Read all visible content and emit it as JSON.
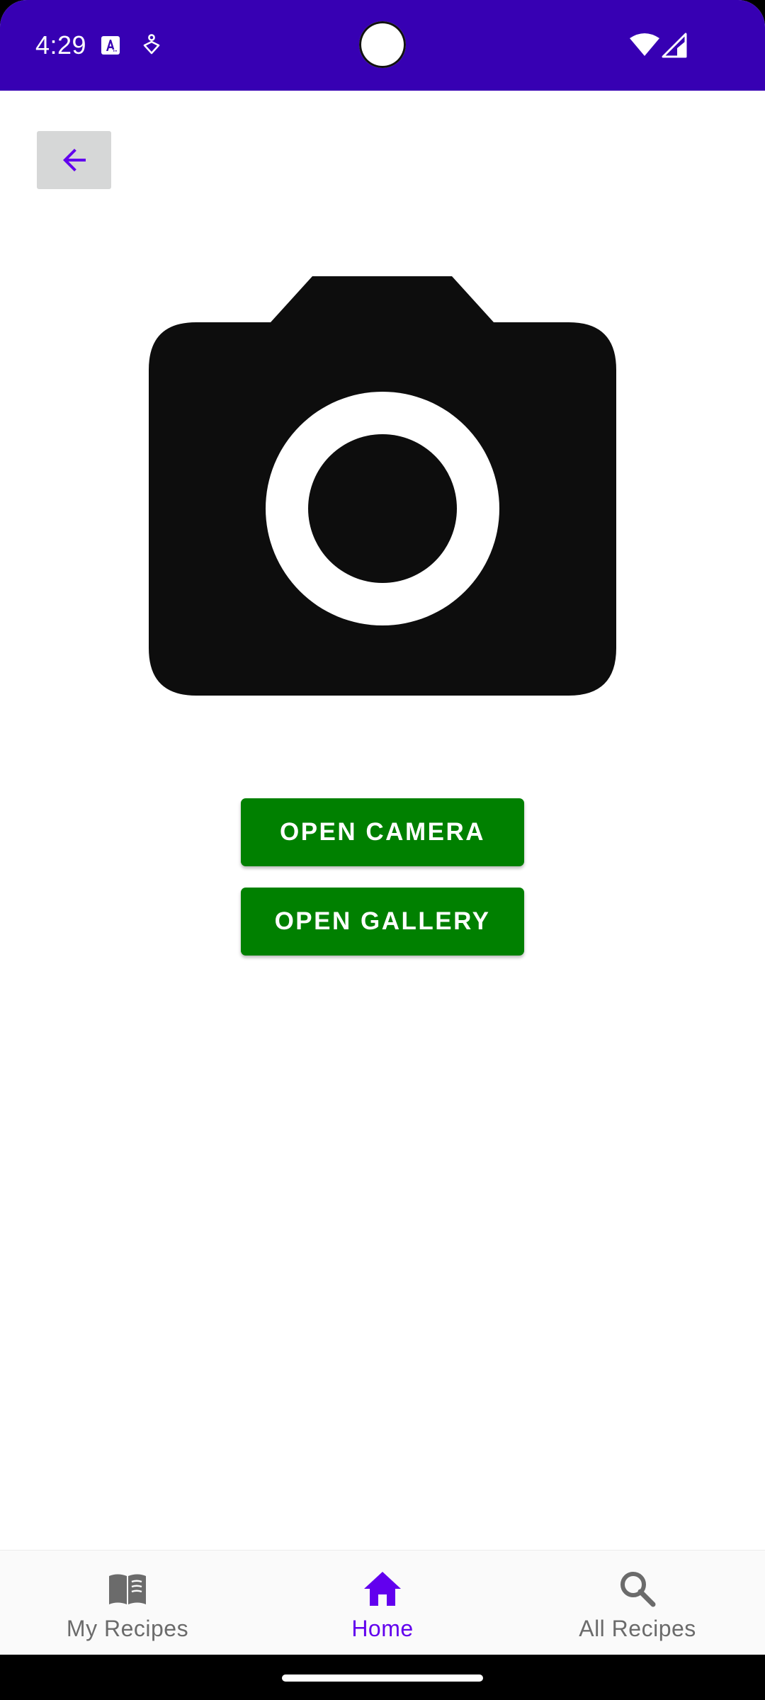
{
  "status_bar": {
    "time": "4:29",
    "background": "#3700b3",
    "icons": [
      "translate-notification-icon",
      "accessibility-notification-icon",
      "wifi-icon",
      "cell-signal-icon"
    ]
  },
  "header": {
    "back_icon": "arrow-back-icon",
    "back_icon_color": "#6200ee"
  },
  "illustration": {
    "icon": "camera-icon"
  },
  "actions": {
    "open_camera_label": "OPEN CAMERA",
    "open_gallery_label": "OPEN GALLERY",
    "button_color": "#008000"
  },
  "bottom_nav": {
    "items": [
      {
        "label": "My Recipes",
        "icon": "book-icon",
        "active": false
      },
      {
        "label": "Home",
        "icon": "home-icon",
        "active": true
      },
      {
        "label": "All Recipes",
        "icon": "search-icon",
        "active": false
      }
    ],
    "active_color": "#6200ee",
    "inactive_color": "#6b6b6b"
  }
}
